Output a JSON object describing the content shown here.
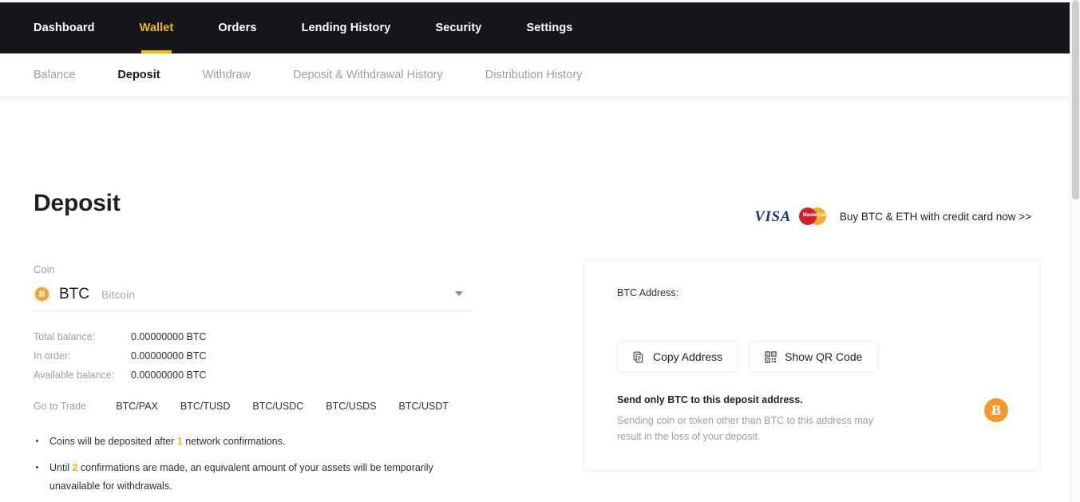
{
  "main_nav": {
    "items": [
      {
        "label": "Dashboard",
        "active": false
      },
      {
        "label": "Wallet",
        "active": true
      },
      {
        "label": "Orders",
        "active": false
      },
      {
        "label": "Lending History",
        "active": false
      },
      {
        "label": "Security",
        "active": false
      },
      {
        "label": "Settings",
        "active": false
      }
    ],
    "accent_color": "#f0b90b",
    "background_color": "#15171c"
  },
  "sub_nav": {
    "items": [
      {
        "label": "Balance",
        "active": false
      },
      {
        "label": "Deposit",
        "active": true
      },
      {
        "label": "Withdraw",
        "active": false
      },
      {
        "label": "Deposit & Withdrawal History",
        "active": false
      },
      {
        "label": "Distribution History",
        "active": false
      }
    ]
  },
  "page": {
    "title": "Deposit"
  },
  "credit_card_banner": {
    "visa_label": "VISA",
    "mastercard_label": "MasterCard",
    "text": "Buy BTC & ETH with credit card now >>"
  },
  "coin_selector": {
    "label": "Coin",
    "symbol": "BTC",
    "name": "Bitcoin",
    "icon": "bitcoin-icon",
    "icon_glyph": "Ƀ",
    "icon_color": "#f1a33a",
    "caret_icon": "chevron-down-icon"
  },
  "balances": [
    {
      "key": "Total balance:",
      "value": "0.00000000 BTC"
    },
    {
      "key": "In order:",
      "value": "0.00000000 BTC"
    },
    {
      "key": "Available balance:",
      "value": "0.00000000 BTC"
    }
  ],
  "go_to_trade": {
    "label": "Go to Trade",
    "pairs": [
      "BTC/PAX",
      "BTC/TUSD",
      "BTC/USDC",
      "BTC/USDS",
      "BTC/USDT"
    ]
  },
  "notes": [
    {
      "before": "Coins will be deposited after ",
      "highlight": "1",
      "after": " network confirmations."
    },
    {
      "before": "Until ",
      "highlight": "2",
      "after": " confirmations are made, an equivalent amount of your assets will be temporarily unavailable for withdrawals."
    }
  ],
  "address_card": {
    "address_label": "BTC Address:",
    "address_value": "",
    "copy_button": {
      "label": "Copy Address",
      "icon": "copy-icon"
    },
    "qr_button": {
      "label": "Show QR Code",
      "icon": "qr-code-icon"
    },
    "warning_title": "Send only BTC to this deposit address.",
    "warning_body": "Sending coin or token other than BTC to this address may result in the loss of your deposit.",
    "coin_icon": "bitcoin-icon",
    "coin_icon_glyph": "Ƀ",
    "coin_icon_color": "#f2982f"
  }
}
